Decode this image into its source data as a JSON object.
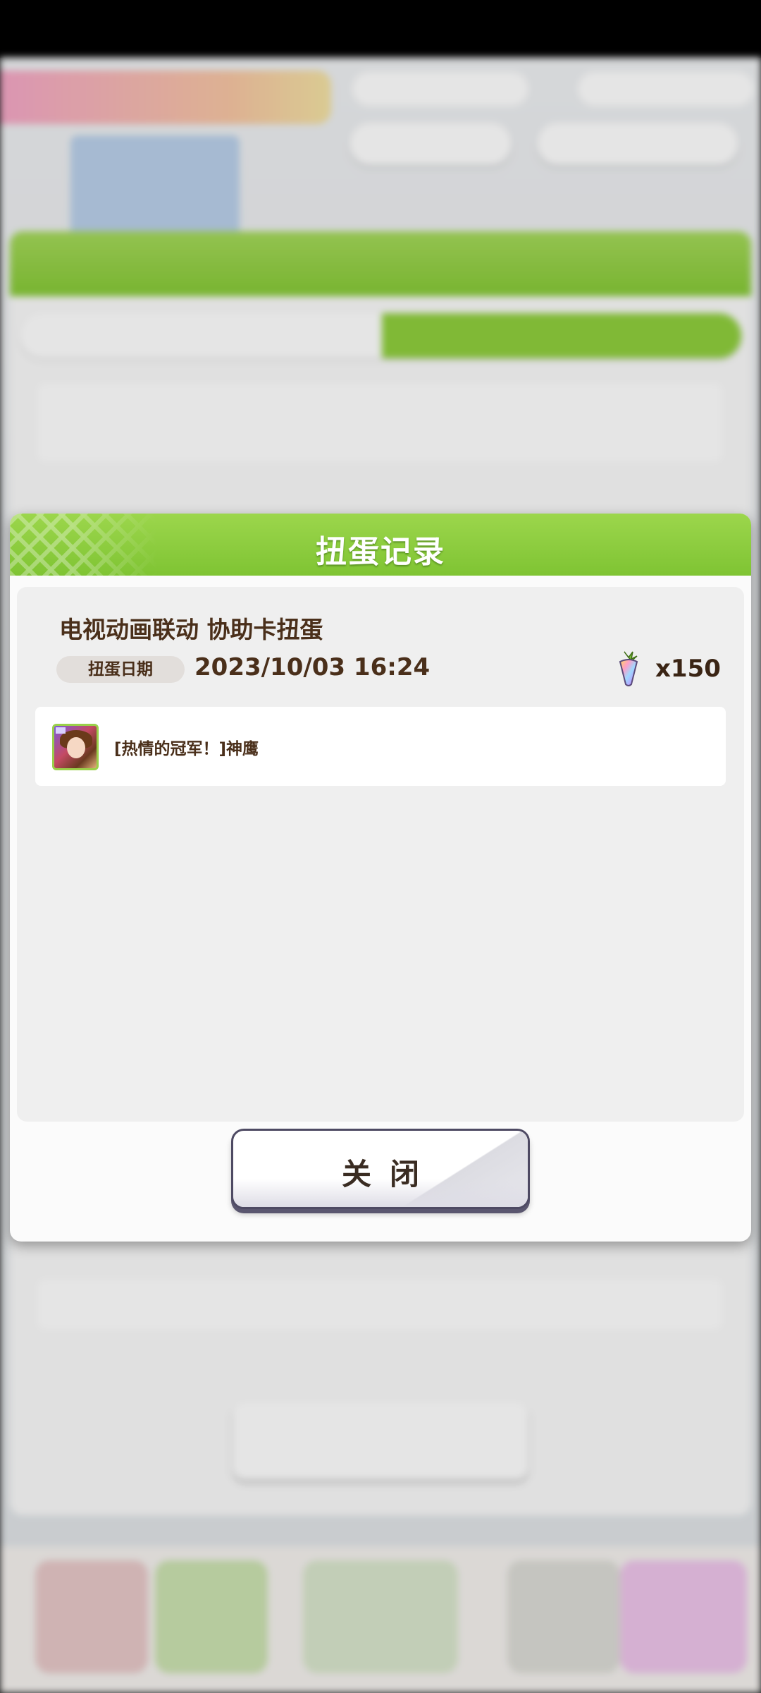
{
  "modal": {
    "title": "扭蛋记录",
    "record": {
      "title": "电视动画联动 协助卡扭蛋",
      "date_label": "扭蛋日期",
      "date_value": "2023/10/03  16:24",
      "cost_icon": "carrot-jewel-icon",
      "cost_value": "x150"
    },
    "results": [
      {
        "card_icon": "support-card-thumbnail",
        "name": "[热情的冠军！]神鹰"
      }
    ],
    "close_label": "关闭"
  },
  "colors": {
    "header_green": "#86c936",
    "text_brown": "#4a2f1a",
    "content_bg": "#efefef"
  }
}
